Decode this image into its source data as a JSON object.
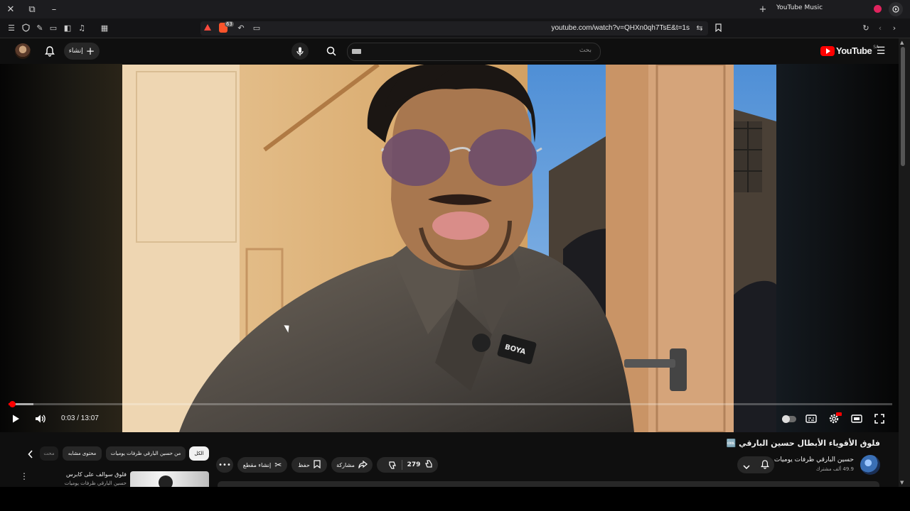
{
  "browser": {
    "tab_title": "YouTube Music",
    "url": "youtube.com/watch?v=QHXn0qh7TsE&t=1s",
    "extension_badge": "63"
  },
  "header": {
    "logo_text": "YouTube",
    "logo_region": "SA",
    "search_placeholder": "بحث",
    "create_label": "إنشاء"
  },
  "player": {
    "time_display": "0:03 / 13:07",
    "progress_fraction": 0.0038,
    "buffered_fraction": 0.028,
    "camera_mic_brand": "BOYA"
  },
  "video": {
    "title": "فلوق الأقوياء الأبطال حسين البارقي 🆒",
    "channel_name": "حسين البارقي ظرفات يوميات",
    "subscribers": "49.9 ألف مشترك",
    "likes": "279",
    "share_label": "مشاركة",
    "save_label": "حفظ",
    "clip_label": "إنشاء مقطع",
    "more_label": "•••"
  },
  "chips": [
    {
      "label": "الكل"
    },
    {
      "label": "من حسين البارقي ظرفات يوميات"
    },
    {
      "label": "محتوى مشابه"
    },
    {
      "label": "محت"
    }
  ],
  "related": {
    "title": "فلوق سوالف على كابرس",
    "subtitle": "حسين البارقي ظرفات يوميات"
  },
  "colors": {
    "accent": "#ff0000",
    "background": "#0f0f0f",
    "chip_bg": "#272727"
  }
}
